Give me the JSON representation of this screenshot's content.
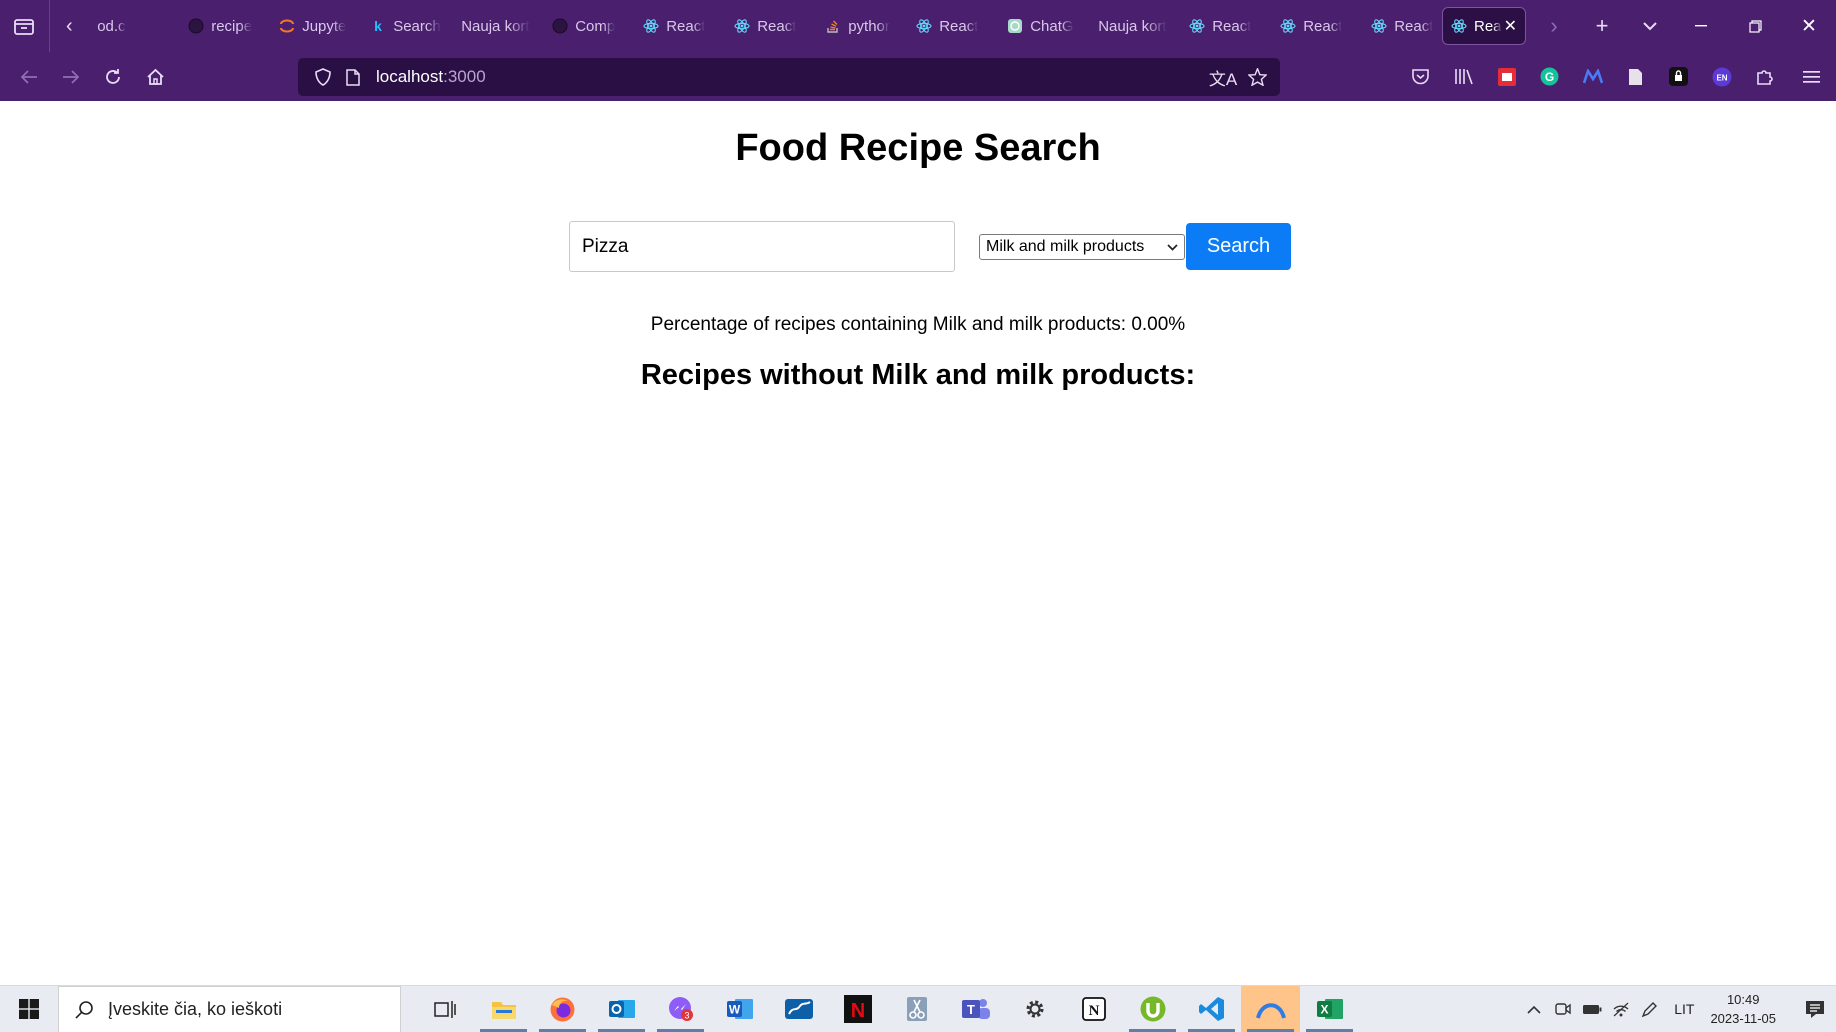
{
  "browser": {
    "tabs": [
      {
        "label": "od.c",
        "icon": "none"
      },
      {
        "label": "recipe",
        "icon": "github-icon"
      },
      {
        "label": "Jupyte",
        "icon": "jupyter-icon"
      },
      {
        "label": "Search",
        "icon": "k-icon"
      },
      {
        "label": "Nauja kort",
        "icon": "none"
      },
      {
        "label": "Comp",
        "icon": "github-icon"
      },
      {
        "label": "React",
        "icon": "react-icon"
      },
      {
        "label": "React",
        "icon": "react-icon"
      },
      {
        "label": "pythor",
        "icon": "stackoverflow-icon"
      },
      {
        "label": "React",
        "icon": "react-icon"
      },
      {
        "label": "ChatG",
        "icon": "chatgpt-icon"
      },
      {
        "label": "Nauja kort",
        "icon": "none"
      },
      {
        "label": "React",
        "icon": "react-icon"
      },
      {
        "label": "React",
        "icon": "react-icon"
      },
      {
        "label": "React",
        "icon": "react-icon"
      }
    ],
    "active_tab": {
      "label": "Rea",
      "icon": "react-icon"
    },
    "url_host": "localhost",
    "url_port": ":3000"
  },
  "app": {
    "title": "Food Recipe Search",
    "search_value": "Pizza",
    "selected_category": "Milk and milk products",
    "search_button": "Search",
    "percentage_text": "Percentage of recipes containing Milk and milk products: 0.00%",
    "results_heading": "Recipes without Milk and milk products:"
  },
  "taskbar": {
    "search_placeholder": "Įveskite čia, ko ieškoti",
    "language": "LIT",
    "time": "10:49",
    "date": "2023-11-05",
    "chat_badge": "3"
  },
  "colors": {
    "browser_chrome": "#4a1f6e",
    "search_button": "#0b7cf5"
  }
}
